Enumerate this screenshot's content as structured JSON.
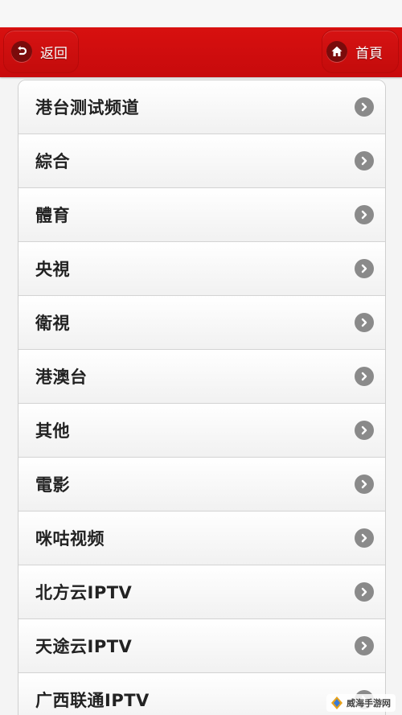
{
  "header": {
    "back_label": "返回",
    "home_label": "首頁",
    "back_icon": "back-arrow-icon",
    "home_icon": "home-icon",
    "accent_color": "#d10c10"
  },
  "list": {
    "items": [
      {
        "label": "港台测试频道"
      },
      {
        "label": "綜合"
      },
      {
        "label": "體育"
      },
      {
        "label": "央視"
      },
      {
        "label": "衛視"
      },
      {
        "label": "港澳台"
      },
      {
        "label": "其他"
      },
      {
        "label": "電影"
      },
      {
        "label": "咪咕视频"
      },
      {
        "label": "北方云IPTV"
      },
      {
        "label": "天途云IPTV"
      },
      {
        "label": "广西联通IPTV"
      }
    ],
    "item_icon": "chevron-right-icon"
  },
  "watermark": {
    "text": "威海手游网"
  }
}
